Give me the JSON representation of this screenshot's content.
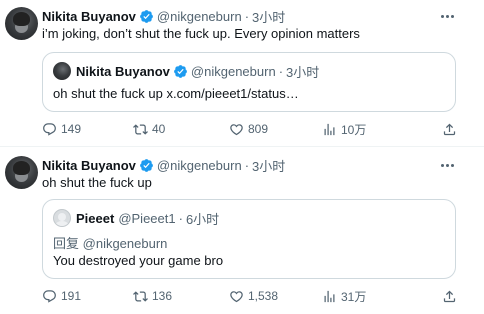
{
  "tweets": [
    {
      "author": {
        "name": "Nikita Buyanov",
        "handle": "@nikgeneburn",
        "verified": true
      },
      "time": "3小时",
      "text": "i’m joking, don’t shut the fuck up. Every opinion matters",
      "quote": {
        "author": {
          "name": "Nikita Buyanov",
          "handle": "@nikgeneburn",
          "verified": true
        },
        "time": "3小时",
        "text": "oh shut the fuck up x.com/pieeet1/status…"
      },
      "stats": {
        "replies": "149",
        "retweets": "40",
        "likes": "809",
        "views": "10万"
      }
    },
    {
      "author": {
        "name": "Nikita Buyanov",
        "handle": "@nikgeneburn",
        "verified": true
      },
      "time": "3小时",
      "text": "oh shut the fuck up",
      "quote": {
        "author": {
          "name": "Pieeet",
          "handle": "@Pieeet1",
          "verified": false
        },
        "time": "6小时",
        "reply_prefix": "回复",
        "reply_to": "@nikgeneburn",
        "text": "You destroyed your game bro"
      },
      "stats": {
        "replies": "191",
        "retweets": "136",
        "likes": "1,538",
        "views": "31万"
      }
    }
  ],
  "separator": "·",
  "colors": {
    "verified": "#1d9bf0",
    "secondary_text": "#536471",
    "border": "#cfd9de"
  },
  "icons": [
    "reply-icon",
    "retweet-icon",
    "like-icon",
    "views-icon",
    "share-icon",
    "verified-badge-icon",
    "more-icon"
  ]
}
